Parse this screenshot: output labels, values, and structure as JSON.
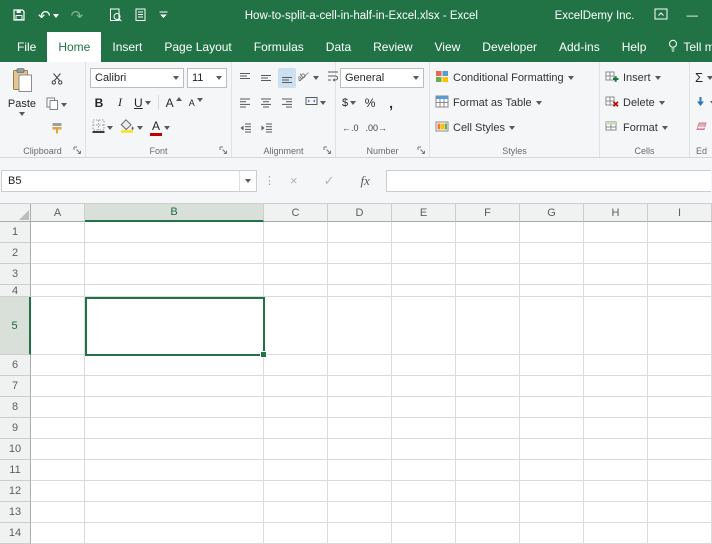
{
  "colors": {
    "excel_green": "#217346",
    "ribbon_bg": "#F5F6F7",
    "selection_border": "#217346",
    "header_highlight_bg": "#D8E0D9",
    "header_highlight_text": "#1E6B43",
    "gridline": "#DBDBDB"
  },
  "title_bar": {
    "title": "How-to-split-a-cell-in-half-in-Excel.xlsx - Excel",
    "account_name": "ExcelDemy Inc.",
    "minimize_glyph": "—",
    "undo_glyph": "↶",
    "redo_glyph": "↷"
  },
  "ribbon_tabs": [
    "File",
    "Home",
    "Insert",
    "Page Layout",
    "Formulas",
    "Data",
    "Review",
    "View",
    "Developer",
    "Add-ins",
    "Help",
    "Tell me"
  ],
  "active_tab": "Home",
  "ribbon": {
    "clipboard": {
      "label": "Clipboard",
      "paste": "Paste"
    },
    "font": {
      "label": "Font",
      "font_name": "Calibri",
      "font_size": "11",
      "bold": "B",
      "italic": "I",
      "underline": "U",
      "grow": "A",
      "shrink": "A",
      "font_color_letter": "A"
    },
    "alignment": {
      "label": "Alignment",
      "orientation_text": "ab"
    },
    "number": {
      "label": "Number",
      "format": "General",
      "currency": "$",
      "percent": "%",
      "comma": ",",
      "increase_decimal": "←.0",
      "decrease_decimal": ".00→"
    },
    "styles": {
      "label": "Styles",
      "conditional_formatting": "Conditional Formatting",
      "format_as_table": "Format as Table",
      "cell_styles": "Cell Styles"
    },
    "cells": {
      "label": "Cells",
      "insert": "Insert",
      "delete": "Delete",
      "format": "Format"
    },
    "editing": {
      "label": "Ed",
      "autosum": "Σ"
    }
  },
  "formula_bar": {
    "name_box": "B5",
    "cancel_glyph": "×",
    "enter_glyph": "✓",
    "fx_label": "fx"
  },
  "grid": {
    "columns": [
      "A",
      "B",
      "C",
      "D",
      "E",
      "F",
      "G",
      "H",
      "I"
    ],
    "rows": [
      "1",
      "2",
      "3",
      "4",
      "5",
      "6",
      "7",
      "8",
      "9",
      "10",
      "11",
      "12",
      "13",
      "14"
    ],
    "selected_cell": "B5",
    "formula_value": ""
  }
}
